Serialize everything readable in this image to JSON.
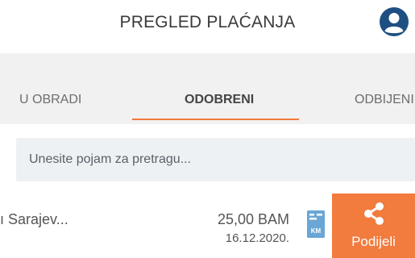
{
  "header": {
    "title": "PREGLED PLAĆANJA",
    "avatar_icon": "user-icon"
  },
  "tabs": [
    {
      "label": "U OBRADI",
      "active": false
    },
    {
      "label": "ODOBRENI",
      "active": true
    },
    {
      "label": "ODBIJENI",
      "active": false
    }
  ],
  "search": {
    "placeholder": "Unesite pojam za pretragu..."
  },
  "payments": [
    {
      "name": "ı Sarajev...",
      "amount": "25,00 BAM",
      "date": "16.12.2020.",
      "doc_icon": "km-document-icon"
    }
  ],
  "actions": {
    "share_label": "Podijeli",
    "share_icon": "share-icon"
  },
  "colors": {
    "accent": "#f27b3e",
    "avatar": "#1e4f82",
    "doc_icon": "#6aa6d6"
  }
}
